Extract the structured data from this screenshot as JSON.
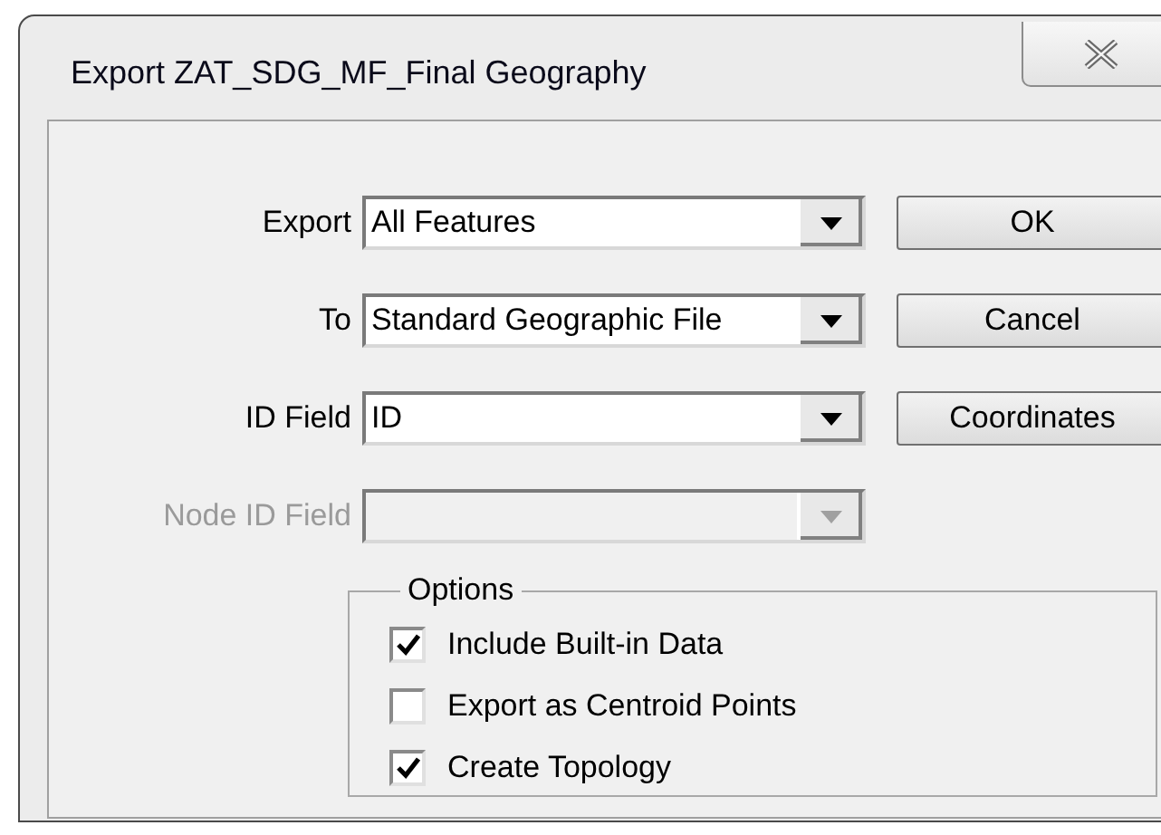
{
  "window": {
    "title": "Export ZAT_SDG_MF_Final Geography"
  },
  "fields": [
    {
      "label": "Export",
      "value": "All Features",
      "disabled": false
    },
    {
      "label": "To",
      "value": "Standard Geographic File",
      "disabled": false
    },
    {
      "label": "ID Field",
      "value": "ID",
      "disabled": false
    },
    {
      "label": "Node ID Field",
      "disabled": true
    }
  ],
  "buttons": [
    "OK",
    "Cancel",
    "Coordinates"
  ],
  "options": {
    "title": "Options",
    "items": [
      {
        "label": "Include Built-in Data",
        "checked": true
      },
      {
        "label": "Export as Centroid Points",
        "checked": false
      },
      {
        "label": "Create Topology",
        "checked": true
      }
    ]
  }
}
